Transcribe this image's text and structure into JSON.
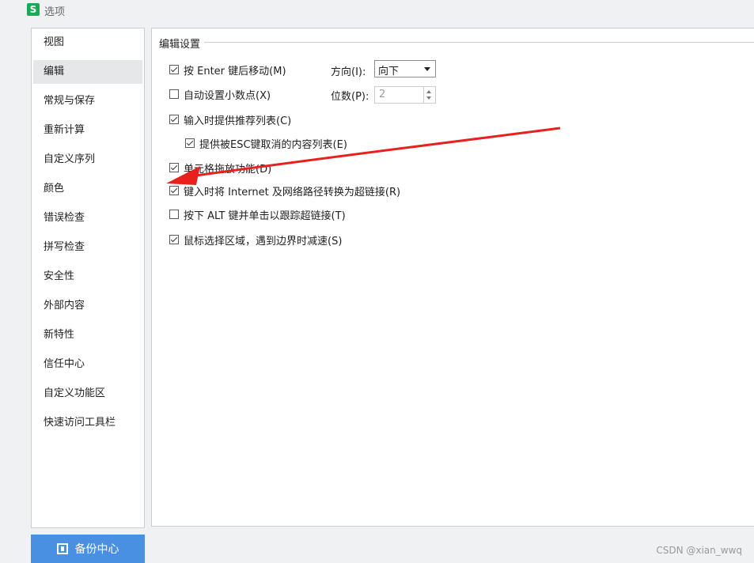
{
  "window": {
    "title": "选项",
    "logo_text": "S"
  },
  "sidebar": {
    "items": [
      {
        "label": "视图",
        "active": false
      },
      {
        "label": "编辑",
        "active": true
      },
      {
        "label": "常规与保存",
        "active": false
      },
      {
        "label": "重新计算",
        "active": false
      },
      {
        "label": "自定义序列",
        "active": false
      },
      {
        "label": "颜色",
        "active": false
      },
      {
        "label": "错误检查",
        "active": false
      },
      {
        "label": "拼写检查",
        "active": false
      },
      {
        "label": "安全性",
        "active": false
      },
      {
        "label": "外部内容",
        "active": false
      },
      {
        "label": "新特性",
        "active": false
      },
      {
        "label": "信任中心",
        "active": false
      },
      {
        "label": "自定义功能区",
        "active": false
      },
      {
        "label": "快速访问工具栏",
        "active": false
      }
    ],
    "backup_button": "备份中心"
  },
  "settings": {
    "section_title": "编辑设置",
    "options": [
      {
        "label": "按 Enter 键后移动(M)",
        "checked": true
      },
      {
        "label": "自动设置小数点(X)",
        "checked": false
      },
      {
        "label": "输入时提供推荐列表(C)",
        "checked": true
      },
      {
        "label": "提供被ESC键取消的内容列表(E)",
        "checked": true
      },
      {
        "label": "单元格拖放功能(D)",
        "checked": true
      },
      {
        "label": "键入时将 Internet 及网络路径转换为超链接(R)",
        "checked": true
      },
      {
        "label": "按下 ALT 键并单击以跟踪超链接(T)",
        "checked": false
      },
      {
        "label": "鼠标选择区域，遇到边界时减速(S)",
        "checked": true
      }
    ],
    "direction": {
      "label": "方向(I):",
      "value": "向下"
    },
    "decimal_places": {
      "label": "位数(P):",
      "value": "2"
    }
  },
  "annotation": {
    "arrow_color": "#e8201e"
  },
  "watermark": "CSDN @xian_wwq"
}
